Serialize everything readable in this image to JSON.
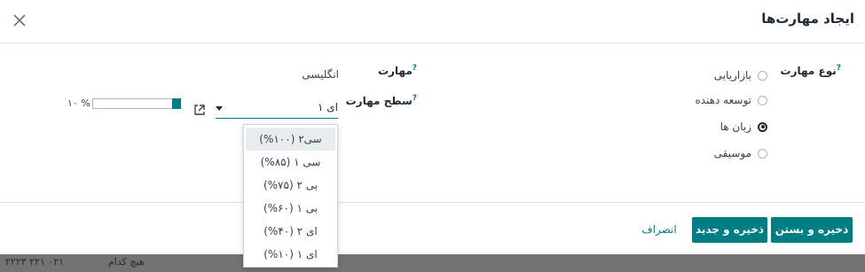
{
  "modal": {
    "title": "ایجاد مهارت‌ها",
    "footer": {
      "save_close": "ذخیره و بستن",
      "save_new": "ذخیره و جدید",
      "discard": "انصراف"
    }
  },
  "form": {
    "skill_type_label": "نوع مهارت",
    "skill_types": [
      {
        "label": "بازاریابی",
        "selected": false
      },
      {
        "label": "توسعه دهنده",
        "selected": false
      },
      {
        "label": "زبان ها",
        "selected": true
      },
      {
        "label": "موسیقی",
        "selected": false
      }
    ],
    "skill_label": "مهارت",
    "skill_value": "انگلیسی",
    "level_label": "سطح مهارت",
    "level_value": "ای ۱",
    "progress_text": "۱۰ %",
    "progress_value": 10,
    "help_mark": "?"
  },
  "dropdown": {
    "options": [
      {
        "label": "سی۲ (۱۰۰%)",
        "active": true
      },
      {
        "label": "سی ۱ (۸۵%)",
        "active": false
      },
      {
        "label": "بی ۲ (۷۵%)",
        "active": false
      },
      {
        "label": "بی ۱ (۶۰%)",
        "active": false
      },
      {
        "label": "ای ۲ (۴۰%)",
        "active": false
      },
      {
        "label": "ای ۱ (۱۰%)",
        "active": false
      }
    ]
  },
  "background": {
    "text_left": "۲۲۲۳ ۲۲۱ ۰۲۱",
    "text_mid": "هیچ کدام"
  },
  "colors": {
    "accent": "#017e84"
  }
}
